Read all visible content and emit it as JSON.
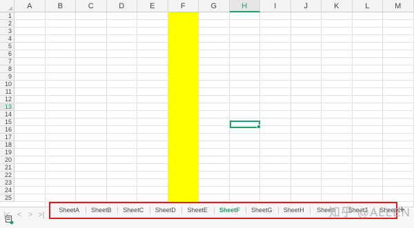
{
  "columns": [
    "A",
    "B",
    "C",
    "D",
    "E",
    "F",
    "G",
    "H",
    "I",
    "J",
    "K",
    "L",
    "M"
  ],
  "active_column": "H",
  "rows": [
    "1",
    "2",
    "3",
    "4",
    "5",
    "6",
    "7",
    "8",
    "9",
    "10",
    "11",
    "12",
    "13",
    "14",
    "15",
    "16",
    "17",
    "18",
    "19",
    "20",
    "21",
    "22",
    "23",
    "24",
    "25"
  ],
  "active_row": "13",
  "highlighted_column": "F",
  "highlight_color": "#ffff00",
  "selection_color": "#1e9c6a",
  "tabs_border_color": "#e0181e",
  "sheet_tabs": [
    {
      "label": "SheetA",
      "active": false
    },
    {
      "label": "SheetB",
      "active": false
    },
    {
      "label": "SheetC",
      "active": false
    },
    {
      "label": "SheetD",
      "active": false
    },
    {
      "label": "SheetE",
      "active": false
    },
    {
      "label": "SheetF",
      "active": true
    },
    {
      "label": "SheetG",
      "active": false
    },
    {
      "label": "SheetH",
      "active": false
    },
    {
      "label": "SheetI",
      "active": false
    },
    {
      "label": "SheetJ",
      "active": false
    },
    {
      "label": "SheetK",
      "active": false
    }
  ],
  "nav_buttons": {
    "first": "|<",
    "prev": "<",
    "next": ">",
    "last": ">|"
  },
  "add_sheet_label": "+",
  "watermark": "知乎 @ALLEN",
  "icons": {
    "status": "macro-record-icon",
    "corner": "select-all-icon"
  }
}
